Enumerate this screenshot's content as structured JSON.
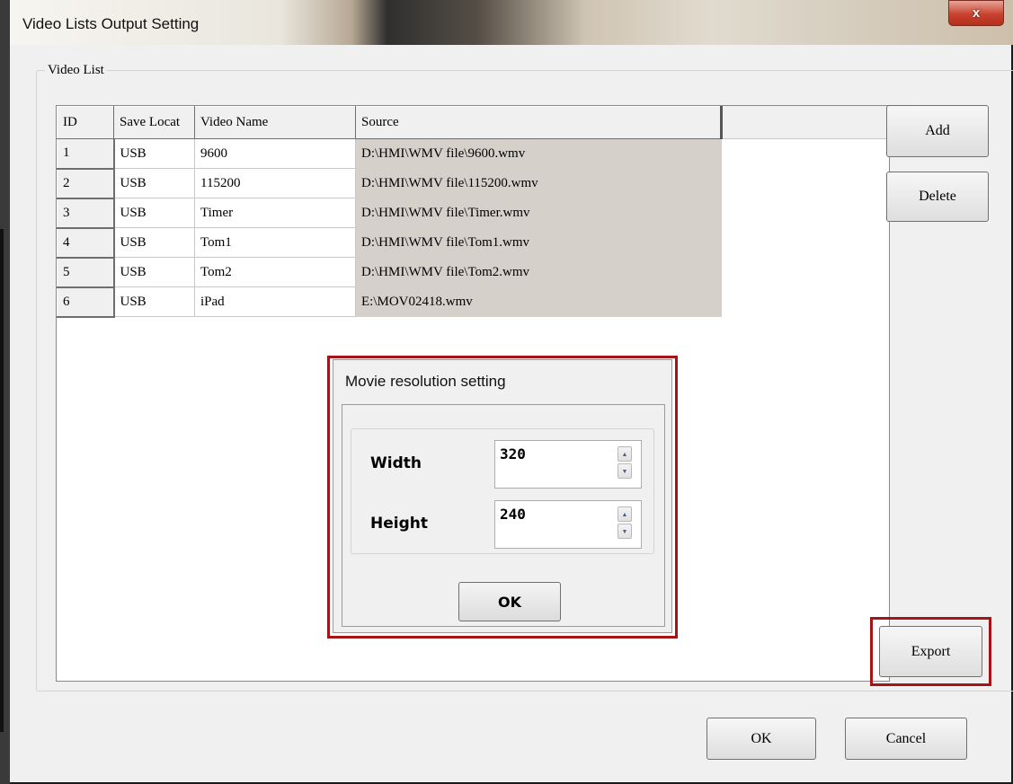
{
  "window": {
    "title": "Video Lists Output Setting",
    "close_glyph": "x"
  },
  "group": {
    "label": "Video List"
  },
  "table": {
    "headers": [
      "ID",
      "Save Locat",
      "Video Name",
      "Source"
    ],
    "rows": [
      {
        "id": "1",
        "location": "USB",
        "name": "9600",
        "source": "D:\\HMI\\WMV file\\9600.wmv"
      },
      {
        "id": "2",
        "location": "USB",
        "name": "115200",
        "source": "D:\\HMI\\WMV file\\115200.wmv"
      },
      {
        "id": "3",
        "location": "USB",
        "name": "Timer",
        "source": "D:\\HMI\\WMV file\\Timer.wmv"
      },
      {
        "id": "4",
        "location": "USB",
        "name": "Tom1",
        "source": "D:\\HMI\\WMV file\\Tom1.wmv"
      },
      {
        "id": "5",
        "location": "USB",
        "name": "Tom2",
        "source": "D:\\HMI\\WMV file\\Tom2.wmv"
      },
      {
        "id": "6",
        "location": "USB",
        "name": "iPad",
        "source": "E:\\MOV02418.wmv"
      }
    ]
  },
  "side_buttons": {
    "add": "Add",
    "delete": "Delete",
    "export": "Export"
  },
  "footer": {
    "ok": "OK",
    "cancel": "Cancel"
  },
  "modal": {
    "title": "Movie resolution setting",
    "width_label": "Width",
    "width_value": "320",
    "height_label": "Height",
    "height_value": "240",
    "ok": "OK"
  },
  "colors": {
    "highlight": "#a51416",
    "source_cell": "#d6d0ca"
  },
  "icons": [
    "close-icon",
    "spin-up-icon",
    "spin-down-icon"
  ]
}
